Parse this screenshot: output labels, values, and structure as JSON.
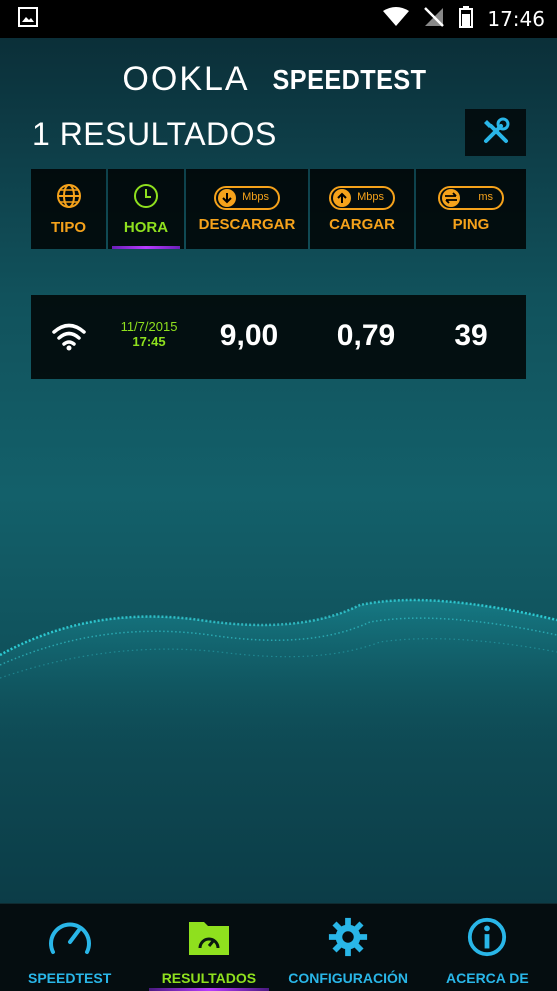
{
  "status_bar": {
    "time": "17:46"
  },
  "logo": {
    "brand": "OOKLA",
    "product": "SPEEDTEST"
  },
  "results_header": {
    "title": "1 RESULTADOS"
  },
  "columns": [
    {
      "label": "TIPO",
      "icon": "globe-icon"
    },
    {
      "label": "HORA",
      "icon": "clock-icon",
      "active": true
    },
    {
      "label": "DESCARGAR",
      "icon": "download-icon",
      "unit": "Mbps"
    },
    {
      "label": "CARGAR",
      "icon": "upload-icon",
      "unit": "Mbps"
    },
    {
      "label": "PING",
      "icon": "ping-icon",
      "unit": "ms"
    }
  ],
  "results": [
    {
      "type": "wifi-icon",
      "date": "11/7/2015",
      "time": "17:45",
      "download": "9,00",
      "upload": "0,79",
      "ping": "39"
    }
  ],
  "bottom_nav": [
    {
      "label": "SPEEDTEST",
      "icon": "speedometer-icon"
    },
    {
      "label": "RESULTADOS",
      "icon": "results-folder-icon",
      "active": true
    },
    {
      "label": "CONFIGURACIÓN",
      "icon": "gear-icon"
    },
    {
      "label": "ACERCA DE",
      "icon": "info-icon"
    }
  ],
  "colors": {
    "accent_orange": "#f5a21b",
    "accent_green": "#8fe01e",
    "accent_blue": "#29b6e8"
  }
}
